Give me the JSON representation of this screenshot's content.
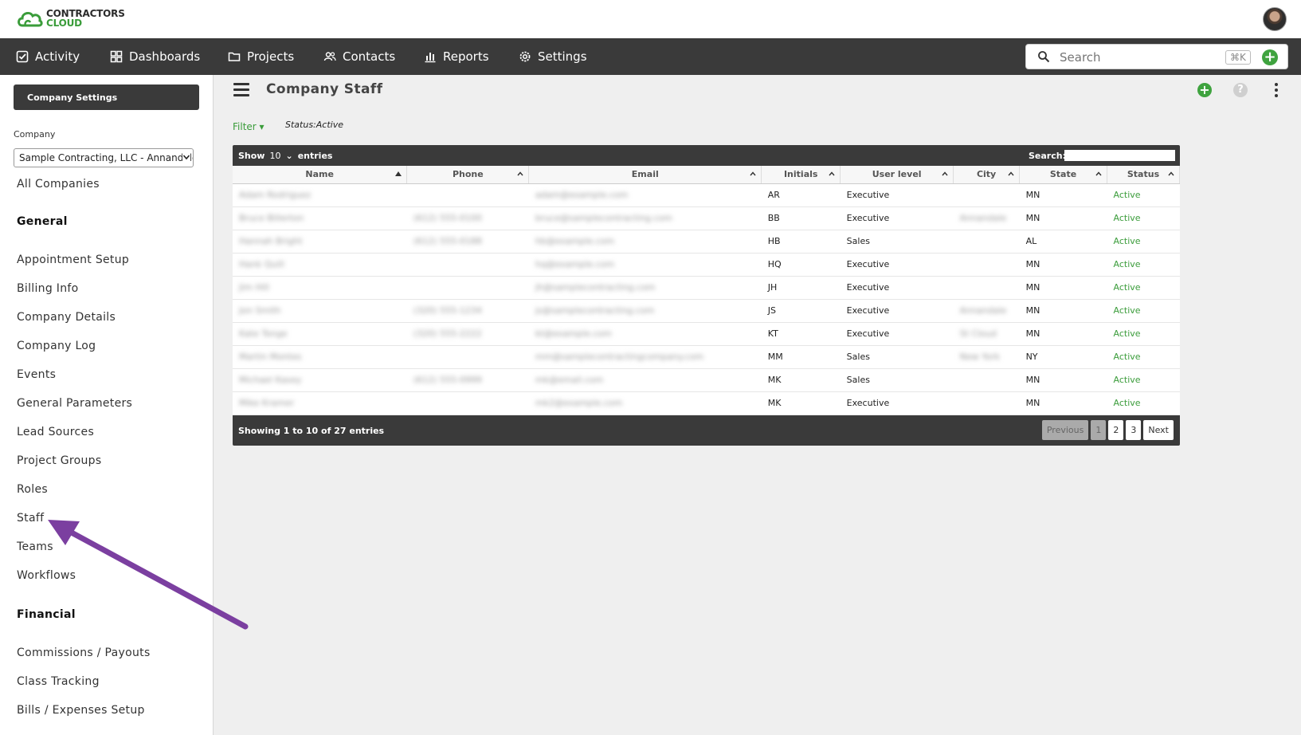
{
  "logo": {
    "line1": "CONTRACTORS",
    "line2": "CLOUD"
  },
  "nav": {
    "items": [
      {
        "label": "Activity",
        "icon": "check-square-icon"
      },
      {
        "label": "Dashboards",
        "icon": "grid-icon"
      },
      {
        "label": "Projects",
        "icon": "folder-icon"
      },
      {
        "label": "Contacts",
        "icon": "people-icon"
      },
      {
        "label": "Reports",
        "icon": "bar-chart-icon"
      },
      {
        "label": "Settings",
        "icon": "gear-icon"
      }
    ],
    "search_placeholder": "Search",
    "shortcut": "⌘K"
  },
  "sidebar": {
    "button": "Company Settings",
    "company_label": "Company",
    "company_value": "Sample Contracting, LLC - Annandale",
    "all_companies": "All Companies",
    "general_head": "General",
    "general": [
      "Appointment Setup",
      "Billing Info",
      "Company Details",
      "Company Log",
      "Events",
      "General Parameters",
      "Lead Sources",
      "Project Groups",
      "Roles",
      "Staff",
      "Teams",
      "Workflows"
    ],
    "financial_head": "Financial",
    "financial": [
      "Commissions / Payouts",
      "Class Tracking",
      "Bills / Expenses Setup"
    ]
  },
  "main": {
    "title": "Company Staff",
    "filter": "Filter",
    "status_filter": "Status:Active",
    "show_label": "Show",
    "show_value": "10",
    "entries_label": "entries",
    "search_label": "Search:",
    "columns": [
      "Name",
      "Phone",
      "Email",
      "Initials",
      "User level",
      "City",
      "State",
      "Status"
    ],
    "rows": [
      {
        "name": "Adam Rodriguez",
        "phone": "",
        "email": "adam@example.com",
        "initials": "AR",
        "level": "Executive",
        "city": "",
        "state": "MN",
        "status": "Active"
      },
      {
        "name": "Bruce Billerton",
        "phone": "(612) 555-0100",
        "email": "bruce@samplecontracting.com",
        "initials": "BB",
        "level": "Executive",
        "city": "Annandale",
        "state": "MN",
        "status": "Active"
      },
      {
        "name": "Hannah Bright",
        "phone": "(612) 555-0188",
        "email": "hb@example.com",
        "initials": "HB",
        "level": "Sales",
        "city": "",
        "state": "AL",
        "status": "Active"
      },
      {
        "name": "Hank Quill",
        "phone": "",
        "email": "hq@example.com",
        "initials": "HQ",
        "level": "Executive",
        "city": "",
        "state": "MN",
        "status": "Active"
      },
      {
        "name": "Jim Hill",
        "phone": "",
        "email": "jh@samplecontracting.com",
        "initials": "JH",
        "level": "Executive",
        "city": "",
        "state": "MN",
        "status": "Active"
      },
      {
        "name": "Jon Smith",
        "phone": "(320) 555-1234",
        "email": "js@samplecontracting.com",
        "initials": "JS",
        "level": "Executive",
        "city": "Annandale",
        "state": "MN",
        "status": "Active"
      },
      {
        "name": "Kate Tonge",
        "phone": "(320) 555-2222",
        "email": "kt@example.com",
        "initials": "KT",
        "level": "Executive",
        "city": "St Cloud",
        "state": "MN",
        "status": "Active"
      },
      {
        "name": "Martin Montes",
        "phone": "",
        "email": "mm@samplecontractingcompany.com",
        "initials": "MM",
        "level": "Sales",
        "city": "New York",
        "state": "NY",
        "status": "Active"
      },
      {
        "name": "Michael Kasey",
        "phone": "(612) 555-0999",
        "email": "mk@email.com",
        "initials": "MK",
        "level": "Sales",
        "city": "",
        "state": "MN",
        "status": "Active"
      },
      {
        "name": "Mike Kramer",
        "phone": "",
        "email": "mk2@example.com",
        "initials": "MK",
        "level": "Executive",
        "city": "",
        "state": "MN",
        "status": "Active"
      }
    ],
    "showing": "Showing 1 to 10 of 27 entries",
    "pager": [
      "Previous",
      "1",
      "2",
      "3",
      "Next"
    ]
  },
  "colors": {
    "accent": "#3a9c3a",
    "dark": "#3a3a3a",
    "annotation_arrow": "#7b3fa0"
  }
}
